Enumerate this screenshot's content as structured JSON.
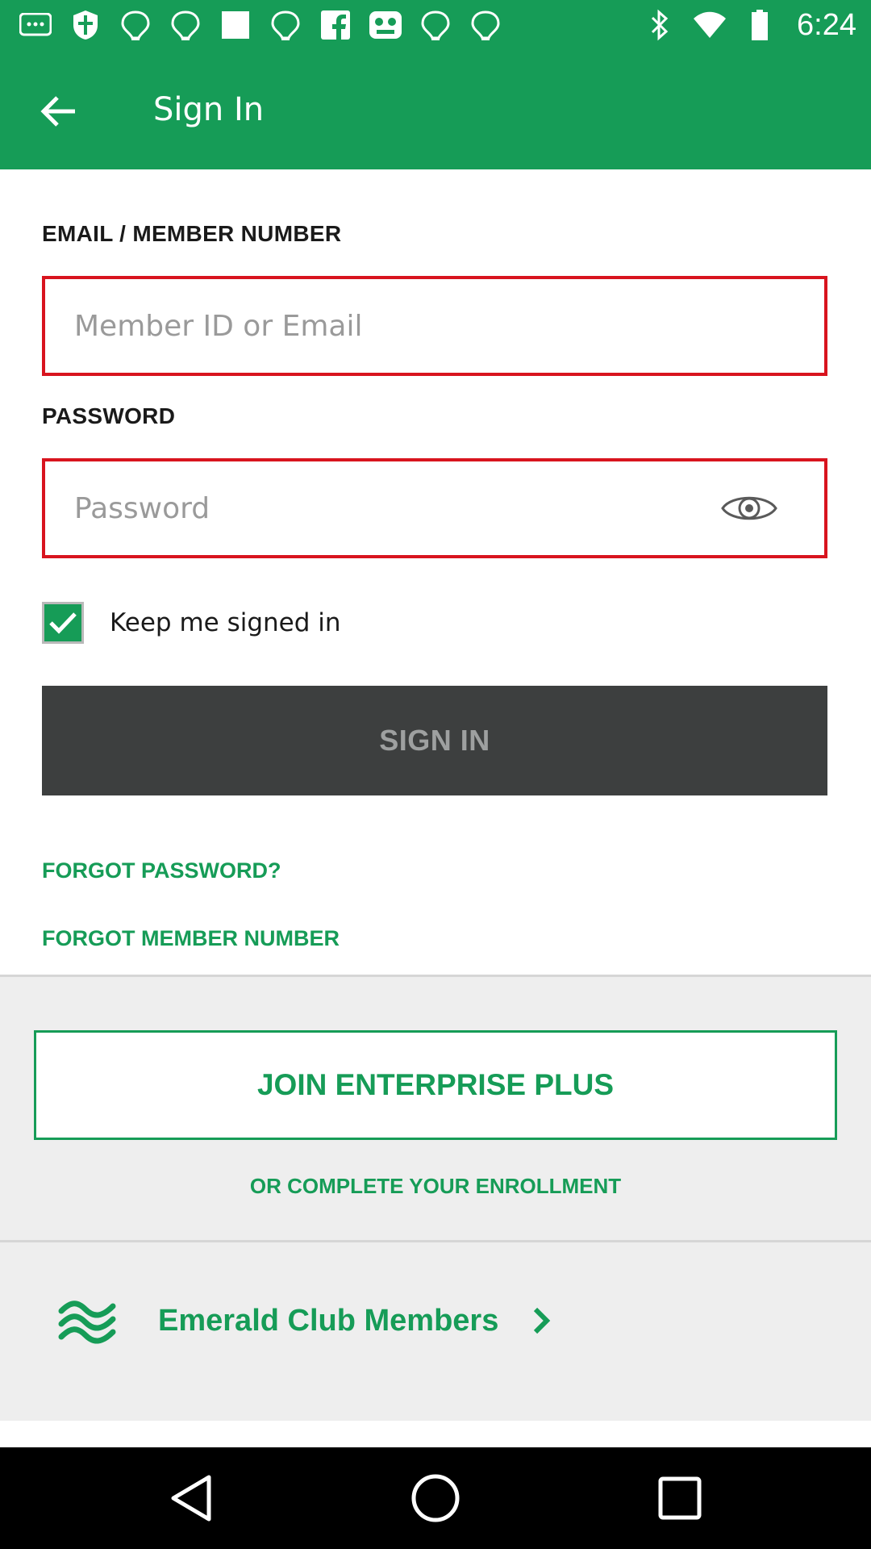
{
  "status_bar": {
    "time": "6:24",
    "icons": [
      "message-icon",
      "shield-icon",
      "wifi-icon",
      "wifi-icon",
      "square-icon",
      "wifi-icon",
      "facebook-icon",
      "game-icon",
      "wifi-icon",
      "wifi-icon",
      "bluetooth-icon",
      "wifi-signal-icon",
      "battery-icon"
    ]
  },
  "app_bar": {
    "title": "Sign In",
    "back_icon": "arrow-left-icon"
  },
  "form": {
    "email_label": "EMAIL / MEMBER NUMBER",
    "email_placeholder": "Member ID or Email",
    "email_value": "",
    "password_label": "PASSWORD",
    "password_placeholder": "Password",
    "password_value": "",
    "keep_signed_in_label": "Keep me signed in",
    "keep_signed_in_checked": true,
    "sign_in_label": "SIGN IN",
    "forgot_password_label": "FORGOT PASSWORD?",
    "forgot_member_number_label": "FORGOT MEMBER NUMBER"
  },
  "enrollment": {
    "join_label": "JOIN ENTERPRISE PLUS",
    "complete_enrollment_label": "OR COMPLETE YOUR ENROLLMENT",
    "emerald_label": "Emerald Club Members"
  },
  "colors": {
    "brand_green": "#169c57",
    "error_red": "#d8141e",
    "button_dark": "#3d3f3f"
  }
}
